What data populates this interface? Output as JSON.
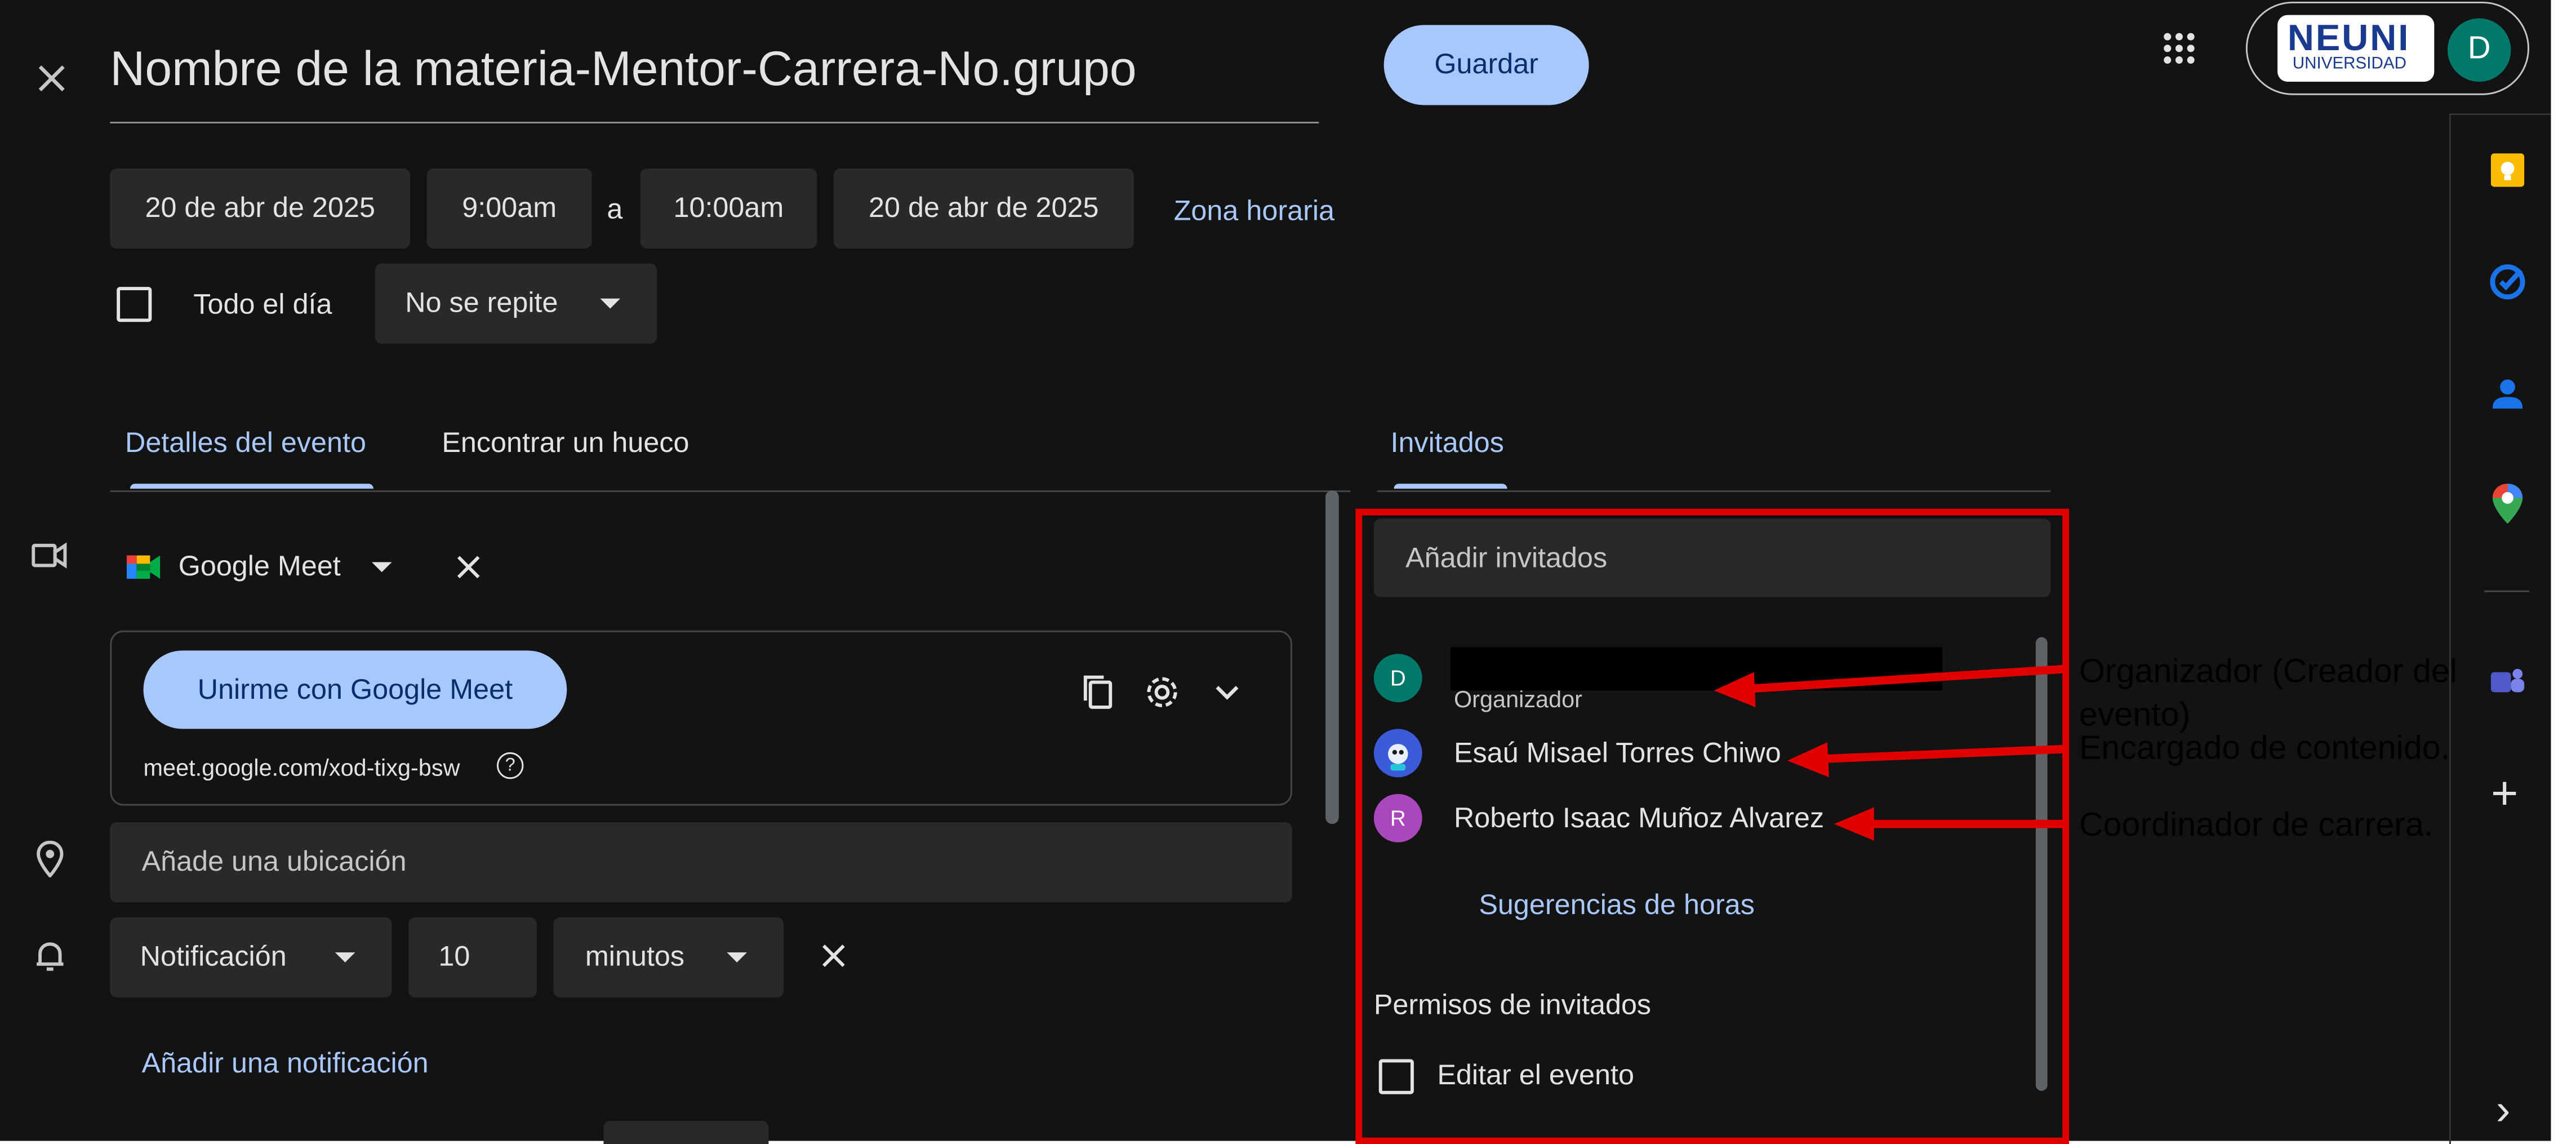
{
  "header": {
    "close_label": "×",
    "title": "Nombre de la materia-Mentor-Carrera-No.grupo",
    "save_label": "Guardar",
    "brand_name": "NEUNI",
    "brand_sub": "UNIVERSIDAD",
    "account_initial": "D"
  },
  "datetime": {
    "start_date": "20 de abr de 2025",
    "start_time": "9:00am",
    "separator": "a",
    "end_time": "10:00am",
    "end_date": "20 de abr de 2025",
    "timezone_label": "Zona horaria",
    "all_day_label": "Todo el día",
    "repeat_label": "No se repite"
  },
  "tabs": {
    "details": "Detalles del evento",
    "find_time": "Encontrar un hueco",
    "guests": "Invitados"
  },
  "conference": {
    "provider": "Google Meet",
    "join_label": "Unirme con Google Meet",
    "link": "meet.google.com/xod-tixg-bsw",
    "help_glyph": "?"
  },
  "location": {
    "placeholder": "Añade una ubicación"
  },
  "notification": {
    "type": "Notificación",
    "amount": "10",
    "unit": "minutos",
    "add_label": "Añadir una notificación"
  },
  "guests": {
    "add_placeholder": "Añadir invitados",
    "list": [
      {
        "initial": "D",
        "name": "",
        "role": "Organizador",
        "color": "#00796b"
      },
      {
        "initial": "",
        "name": "Esaú Misael Torres Chiwo",
        "role": "",
        "color": "#3b5bdb"
      },
      {
        "initial": "R",
        "name": "Roberto Isaac Muñoz Alvarez",
        "role": "",
        "color": "#ab47bc"
      }
    ],
    "suggestions_label": "Sugerencias de horas",
    "permissions_title": "Permisos de invitados",
    "edit_event_label": "Editar el evento"
  },
  "annotations": {
    "organizer_line1": "Organizador (Creador del",
    "organizer_line2": "evento)",
    "content": "Encargado de contenido.",
    "coordinator": "Coordinador de carrera."
  },
  "side_panel": {
    "icons": [
      "keep-icon",
      "tasks-icon",
      "contacts-icon",
      "maps-icon",
      "teams-icon",
      "add-icon",
      "expand-icon"
    ],
    "add_glyph": "+",
    "expand_glyph": "›"
  },
  "colors": {
    "background": "#131314",
    "surface": "#28292a",
    "accent": "#a8c7fa",
    "annotation_red": "#e00000"
  }
}
